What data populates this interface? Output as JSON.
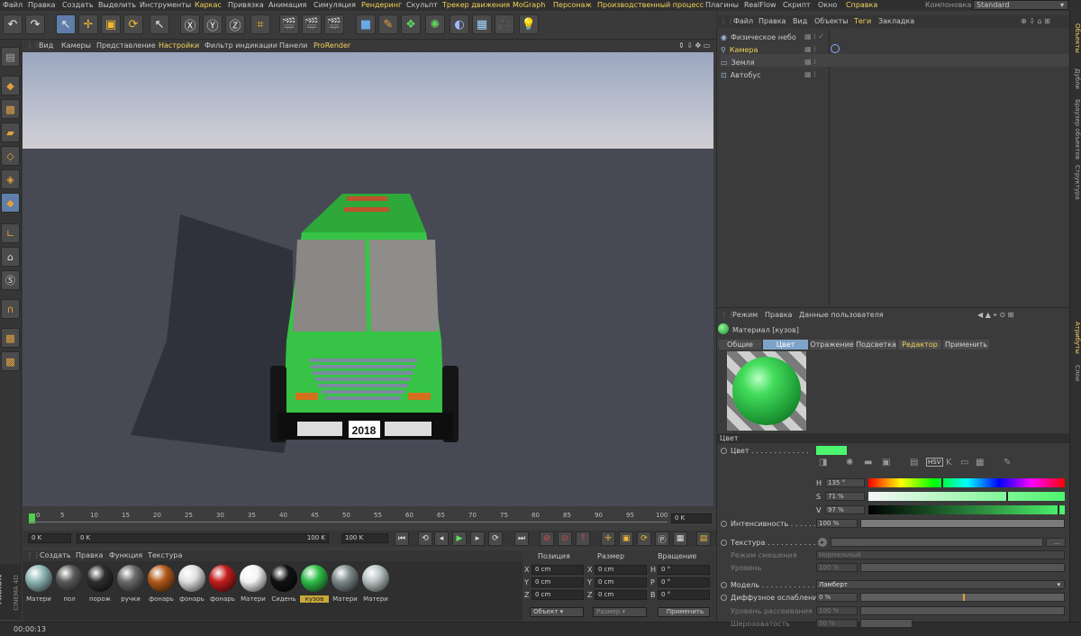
{
  "menu": {
    "items": [
      "Файл",
      "Правка",
      "Создать",
      "Выделить",
      "Инструменты",
      "Каркас",
      "Привязка",
      "Анимация",
      "Симуляция",
      "Рендеринг",
      "Скульпт",
      "Трекер движения",
      "MoGraph",
      "Персонаж",
      "Производственный процесс",
      "Плагины",
      "RealFlow",
      "Скрипт",
      "Окно",
      "Справка"
    ],
    "layout_label": "Компоновка",
    "layout_value": "Standard"
  },
  "viewport_menu": [
    "Вид",
    "Камеры",
    "Представление",
    "Настройки",
    "Фильтр индикации",
    "Панели",
    "ProRender"
  ],
  "scene": {
    "license_plate": "2018"
  },
  "timeline": {
    "ticks": [
      "0",
      "5",
      "10",
      "15",
      "20",
      "25",
      "30",
      "35",
      "40",
      "45",
      "50",
      "55",
      "60",
      "65",
      "70",
      "75",
      "80",
      "85",
      "90",
      "95",
      "100"
    ],
    "current_frame": "0 K",
    "start_field": "0 K",
    "range_start": "0 K",
    "range_end": "100 K",
    "end_field": "100 K"
  },
  "material_manager": {
    "menu": [
      "Создать",
      "Правка",
      "Функция",
      "Текстура"
    ],
    "materials": [
      {
        "label": "Матери",
        "color": "#8fb7b7"
      },
      {
        "label": "пол",
        "color": "#5a5a5a"
      },
      {
        "label": "порож",
        "color": "#2e2e2e"
      },
      {
        "label": "ручки",
        "color": "#6a6a6a"
      },
      {
        "label": "фонарь",
        "color": "#b35a1a"
      },
      {
        "label": "фонарь",
        "color": "#e0e0e0"
      },
      {
        "label": "фонарь",
        "color": "#c41d1d"
      },
      {
        "label": "Матери",
        "color": "#f4f4f4"
      },
      {
        "label": "Сидень",
        "color": "#111111"
      },
      {
        "label": "кузов",
        "color": "#2fbf4a",
        "selected": true
      },
      {
        "label": "Матери",
        "color": "#7f8a8a"
      },
      {
        "label": "Матери",
        "color": "#b9c2c2"
      }
    ]
  },
  "coordinates": {
    "headers": [
      "Позиция",
      "Размер",
      "Вращение"
    ],
    "rows": [
      {
        "axis": "X",
        "pos": "0 cm",
        "sizeaxis": "X",
        "size": "0 cm",
        "rotaxis": "H",
        "rot": "0 °"
      },
      {
        "axis": "Y",
        "pos": "0 cm",
        "sizeaxis": "Y",
        "size": "0 cm",
        "rotaxis": "P",
        "rot": "0 °"
      },
      {
        "axis": "Z",
        "pos": "0 cm",
        "sizeaxis": "Z",
        "size": "0 cm",
        "rotaxis": "B",
        "rot": "0 °"
      }
    ],
    "mode": "Объект",
    "size_mode": "Размер",
    "apply": "Применить"
  },
  "status": {
    "time": "00:00:13"
  },
  "object_manager": {
    "menu": [
      "Файл",
      "Правка",
      "Вид",
      "Объекты",
      "Теги",
      "Закладка"
    ],
    "objects": [
      {
        "name": "Физическое небо",
        "selected": false
      },
      {
        "name": "Камера",
        "selected": true
      },
      {
        "name": "Земля",
        "selected": false
      },
      {
        "name": "Автобус",
        "selected": false
      }
    ]
  },
  "right_tabs": [
    "Объекты",
    "Дубли",
    "Браузер объектов",
    "Структура",
    "Атрибуты",
    "Слои"
  ],
  "attributes": {
    "menu": [
      "Режим",
      "Правка",
      "Данные пользователя"
    ],
    "material_title": "Материал [кузов]",
    "tabs": [
      "Общие",
      "Цвет",
      "Отражение",
      "Подсветка",
      "Редактор",
      "Применить"
    ],
    "section": "Цвет",
    "color_label": "Цвет . . . . . . . . . . . . .",
    "color_swatch": "#4cf56d",
    "h_label": "H",
    "h_value": "135 °",
    "s_label": "S",
    "s_value": "71 %",
    "v_label": "V",
    "v_value": "97 %",
    "intensity_label": "Интенсивность . . . . . . . . .",
    "intensity_value": "100 %",
    "texture_label": "Текстура . . . . . . . . . . . . .",
    "texture_button": "...",
    "blend_mode_label": "Режим смешения",
    "blend_mode_value": "Нормальный",
    "strength_label": "Уровень",
    "strength_value": "100 %",
    "model_label": "Модель . . . . . . . . . . . . .",
    "model_value": "Ламберт",
    "diffuse_label": "Диффузное ослабление",
    "diffuse_value": "0 %",
    "diffuse_level_label": "Уровень рассеивания",
    "diffuse_level_value": "100 %",
    "roughness_label": "Шероховатость",
    "roughness_value": "50 %"
  }
}
